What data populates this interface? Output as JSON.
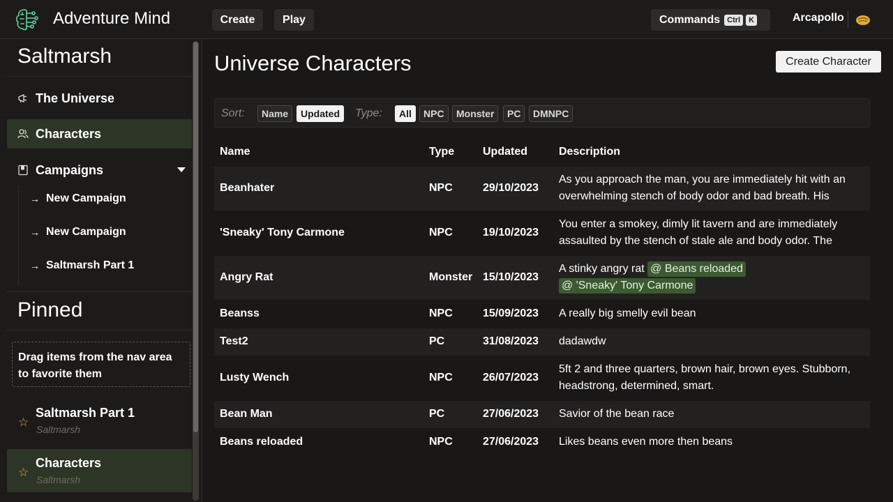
{
  "app": {
    "title": "Adventure Mind"
  },
  "topbar": {
    "create_label": "Create",
    "play_label": "Play",
    "commands_label": "Commands",
    "shortcut_ctrl": "Ctrl",
    "shortcut_key": "K",
    "username": "Arcapollo"
  },
  "sidebar": {
    "universe_title": "Saltmarsh",
    "nav": {
      "universe": "The Universe",
      "characters": "Characters",
      "campaigns": "Campaigns"
    },
    "campaigns": [
      "New Campaign",
      "New Campaign",
      "Saltmarsh Part 1"
    ],
    "pinned_title": "Pinned",
    "pinned_hint": "Drag items from the nav area to favorite them",
    "pinned": [
      {
        "title": "Saltmarsh Part 1",
        "subtitle": "Saltmarsh"
      },
      {
        "title": "Characters",
        "subtitle": "Saltmarsh"
      }
    ]
  },
  "main": {
    "title": "Universe Characters",
    "create_button": "Create Character",
    "sort_label": "Sort:",
    "sort_options": [
      "Name",
      "Updated"
    ],
    "sort_selected": "Updated",
    "type_label": "Type:",
    "type_options": [
      "All",
      "NPC",
      "Monster",
      "PC",
      "DMNPC"
    ],
    "type_selected": "All",
    "columns": [
      "Name",
      "Type",
      "Updated",
      "Description"
    ],
    "rows": [
      {
        "name": "Beanhater",
        "type": "NPC",
        "updated": "29/10/2023",
        "description": "As you approach the man, you are immediately hit with an overwhelming stench of body odor and bad breath. His"
      },
      {
        "name": "'Sneaky' Tony Carmone",
        "type": "NPC",
        "updated": "19/10/2023",
        "description": "You enter a smokey, dimly lit tavern and are immediately assaulted by the stench of stale ale and body odor. The"
      },
      {
        "name": "Angry Rat",
        "type": "Monster",
        "updated": "15/10/2023",
        "description": "A stinky angry rat",
        "mentions": [
          "@ Beans reloaded",
          "@ 'Sneaky' Tony Carmone"
        ]
      },
      {
        "name": "Beanss",
        "type": "NPC",
        "updated": "15/09/2023",
        "description": "A really big smelly evil bean"
      },
      {
        "name": "Test2",
        "type": "PC",
        "updated": "31/08/2023",
        "description": "dadawdw"
      },
      {
        "name": "Lusty Wench",
        "type": "NPC",
        "updated": "26/07/2023",
        "description": "5ft 2 and three quarters, brown hair, brown eyes. Stubborn, headstrong, determined, smart."
      },
      {
        "name": "Bean Man",
        "type": "PC",
        "updated": "27/06/2023",
        "description": "Savior of the bean race"
      },
      {
        "name": "Beans reloaded",
        "type": "NPC",
        "updated": "27/06/2023",
        "description": "Likes beans even more then beans"
      }
    ]
  },
  "colors": {
    "accent": "#5fd6a0",
    "active_bg": "#2d3526",
    "mention_bg": "#3c5a31",
    "star": "#d9b43e"
  }
}
